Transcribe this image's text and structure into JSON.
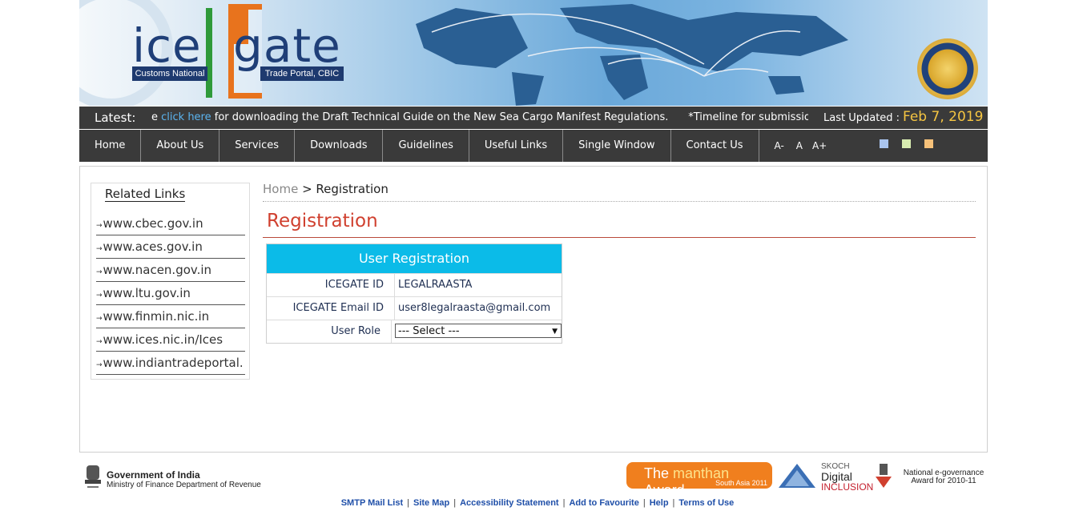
{
  "header": {
    "logo_ice": "ice",
    "logo_gate": "gate",
    "logo_left_tag": "Customs National",
    "logo_right_tag": "Trade Portal, CBIC"
  },
  "ticker": {
    "latest_label": "Latest:",
    "leading_fragment": "e",
    "link_text": "click here",
    "message": " for downloading the Draft Technical Guide on the New Sea Cargo Manifest Regulations.",
    "message2": "*Timeline for submissio",
    "updated_label": "Last Updated :",
    "updated_date": "Feb 7, 2019"
  },
  "nav": {
    "items": [
      "Home",
      "About Us",
      "Services",
      "Downloads",
      "Guidelines",
      "Useful Links",
      "Single Window",
      "Contact Us"
    ],
    "font_sizes": [
      "A-",
      "A",
      "A+"
    ],
    "themes": [
      {
        "name": "blue-theme",
        "color": "#a9c4ee"
      },
      {
        "name": "green-theme",
        "color": "#d8ecb0"
      },
      {
        "name": "orange-theme",
        "color": "#f7c27a"
      }
    ]
  },
  "related": {
    "title": "Related Links",
    "links": [
      "www.cbec.gov.in",
      "www.aces.gov.in",
      "www.nacen.gov.in",
      "www.ltu.gov.in",
      "www.finmin.nic.in",
      "www.ices.nic.in/Ices",
      "www.indiantradeportal."
    ]
  },
  "breadcrumb": {
    "home": "Home",
    "sep": " > ",
    "current": "Registration"
  },
  "page_title": "Registration",
  "form": {
    "header": "User Registration",
    "rows": [
      {
        "label": "ICEGATE ID",
        "value": "LEGALRAASTA"
      },
      {
        "label": "ICEGATE Email ID",
        "value": "user8legalraasta@gmail.com"
      }
    ],
    "role_label": "User Role",
    "role_selected": "--- Select ---"
  },
  "footer": {
    "goi_title": "Government of India",
    "goi_sub": "Ministry of Finance Department of Revenue",
    "award_manthan_pre": "The ",
    "award_manthan_mid": "manthan",
    "award_manthan_post": " Award",
    "award_manthan_sub": "South Asia 2011",
    "award_skoch_top": "SKOCH",
    "award_skoch_mid": "Digital",
    "award_skoch_bot": "INCLUSION",
    "award_egov": "National e-governance Award for 2010-11",
    "links": [
      "SMTP Mail List",
      "Site Map",
      "Accessibility Statement",
      "Add to Favourite",
      "Help",
      "Terms of Use"
    ]
  },
  "colors": {
    "nav_bg": "#3a3a3a",
    "form_header": "#0bbbe8",
    "title_red": "#d0402f",
    "date_gold": "#f5c542",
    "link_blue": "#5bb4f0"
  }
}
